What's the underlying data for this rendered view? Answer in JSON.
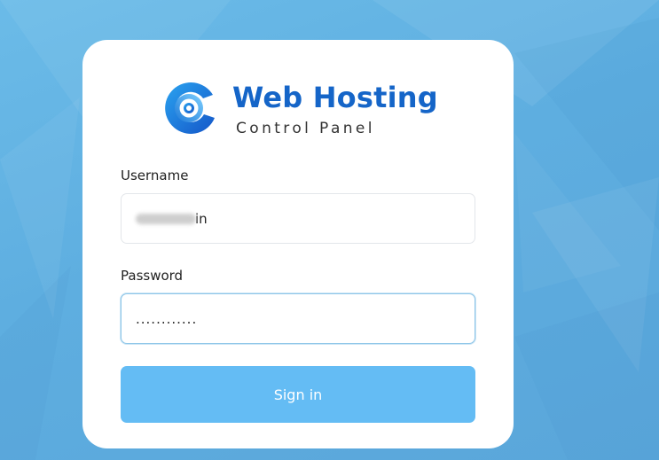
{
  "brand": {
    "title": "Web Hosting",
    "subtitle": "Control Panel",
    "logo_icon": "c-ring-logo-icon",
    "color": "#1565c8"
  },
  "form": {
    "username": {
      "label": "Username",
      "value": "in",
      "redacted_prefix": true
    },
    "password": {
      "label": "Password",
      "value": "............"
    },
    "submit_label": "Sign in"
  },
  "colors": {
    "background": "#5eaee0",
    "button": "#64bcf4",
    "focus_border": "#8ec6e8"
  }
}
